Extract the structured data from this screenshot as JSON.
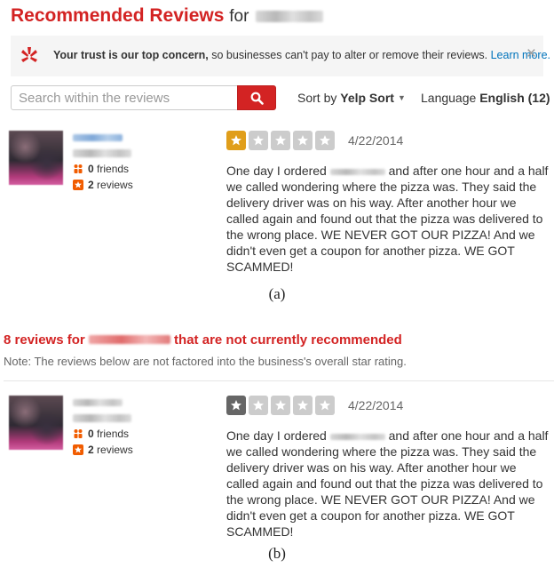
{
  "top": {
    "heading_red": "Recommended Reviews",
    "heading_for": "for",
    "trust_bold": "Your trust is our top concern,",
    "trust_rest": " so businesses can't pay to alter or remove their reviews. ",
    "learn_more": "Learn more.",
    "close_glyph": "×"
  },
  "search": {
    "placeholder": "Search within the reviews",
    "sort_prefix": "Sort by ",
    "sort_value": "Yelp Sort",
    "language_prefix": "Language ",
    "language_value": "English (12)"
  },
  "review": {
    "friends_count": "0",
    "friends_label": " friends",
    "reviews_count": "2",
    "reviews_label": " reviews",
    "date": "4/22/2014",
    "rating": 1,
    "text_before": "One day I ordered ",
    "text_after": " and after one hour and a half we called wondering where the pizza was. They said the delivery driver was on his way. After another hour we called again and found out that the pizza was delivered to the wrong place. WE NEVER GOT OUR PIZZA!  And we didn't even get a coupon for another pizza. WE GOT SCAMMED!"
  },
  "captions": {
    "a": "(a)",
    "b": "(b)"
  },
  "not_recommended": {
    "count_prefix": "8 reviews for ",
    "suffix": " that are not currently recommended",
    "note": "Note: The reviews below are not factored into the business's overall star rating."
  },
  "colors": {
    "brand_red": "#d32323",
    "star_yellow": "#e09e1a",
    "star_dark": "#666666",
    "link_blue": "#0073bb"
  },
  "icons": {
    "search": "search-icon",
    "close": "close-icon",
    "burst": "yelp-burst-icon",
    "friends": "friends-icon",
    "reviews": "reviews-star-icon",
    "star": "star-icon"
  }
}
